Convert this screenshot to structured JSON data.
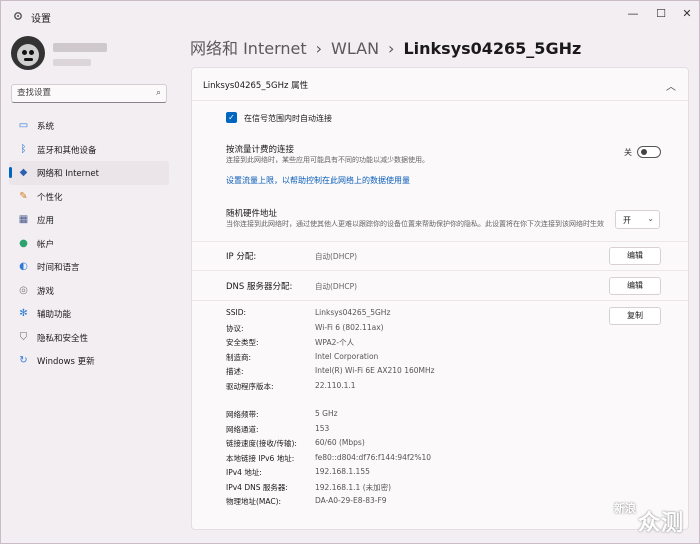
{
  "window": {
    "title": "设置",
    "min_icon": "minimize-icon",
    "max_icon": "maximize-icon",
    "close_icon": "close-icon"
  },
  "search": {
    "placeholder": "查找设置"
  },
  "nav": {
    "items": [
      {
        "label": "系统",
        "icon": "monitor-icon",
        "color": "#2f7bd6",
        "active": false
      },
      {
        "label": "蓝牙和其他设备",
        "icon": "bluetooth-icon",
        "color": "#1e6ec8",
        "active": false
      },
      {
        "label": "网络和 Internet",
        "icon": "wifi-icon",
        "color": "#2d5fb3",
        "active": true
      },
      {
        "label": "个性化",
        "icon": "brush-icon",
        "color": "#d27a1e",
        "active": false
      },
      {
        "label": "应用",
        "icon": "apps-icon",
        "color": "#4a5a8a",
        "active": false
      },
      {
        "label": "帐户",
        "icon": "account-icon",
        "color": "#2aa36c",
        "active": false
      },
      {
        "label": "时间和语言",
        "icon": "globe-clock-icon",
        "color": "#2f7bd6",
        "active": false
      },
      {
        "label": "游戏",
        "icon": "gamepad-icon",
        "color": "#777777",
        "active": false
      },
      {
        "label": "辅助功能",
        "icon": "accessibility-icon",
        "color": "#2f7bd6",
        "active": false
      },
      {
        "label": "隐私和安全性",
        "icon": "shield-icon",
        "color": "#666666",
        "active": false
      },
      {
        "label": "Windows 更新",
        "icon": "update-icon",
        "color": "#2f7bd6",
        "active": false
      }
    ]
  },
  "breadcrumb": {
    "part1": "网络和 Internet",
    "part2": "WLAN",
    "current": "Linksys04265_5GHz"
  },
  "panel": {
    "title": "Linksys04265_5GHz 属性",
    "auto_connect": {
      "label": "在信号范围内时自动连接",
      "checked": true
    },
    "metered": {
      "label": "按流量计费的连接",
      "sub": "连接到此网络时，某些应用可能具有不同的功能以减少数据使用。",
      "toggle_text": "关",
      "on": false
    },
    "data_limit_link": "设置流量上限，以帮助控制在此网络上的数据使用量",
    "random_mac": {
      "label": "随机硬件地址",
      "sub": "当你连接到此网络时，通过使其他人更难以跟踪你的设备位置来帮助保护你的隐私。此设置将在你下次连接到该网络时生效",
      "value": "开"
    },
    "ip": {
      "label": "IP 分配:",
      "value": "自动(DHCP)",
      "button": "编辑"
    },
    "dns": {
      "label": "DNS 服务器分配:",
      "value": "自动(DHCP)",
      "button": "编辑"
    },
    "copy_button": "复制",
    "props1": [
      {
        "k": "SSID:",
        "v": "Linksys04265_5GHz"
      },
      {
        "k": "协议:",
        "v": "Wi-Fi 6 (802.11ax)"
      },
      {
        "k": "安全类型:",
        "v": "WPA2-个人"
      },
      {
        "k": "制造商:",
        "v": "Intel Corporation"
      },
      {
        "k": "描述:",
        "v": "Intel(R) Wi-Fi 6E AX210 160MHz"
      },
      {
        "k": "驱动程序版本:",
        "v": "22.110.1.1"
      }
    ],
    "props2": [
      {
        "k": "网络频带:",
        "v": "5 GHz"
      },
      {
        "k": "网络通道:",
        "v": "153"
      },
      {
        "k": "链接速度(接收/传输):",
        "v": "60/60 (Mbps)"
      },
      {
        "k": "本地链接 IPv6 地址:",
        "v": "fe80::d804:df76:f144:94f2%10"
      },
      {
        "k": "IPv4 地址:",
        "v": "192.168.1.155"
      },
      {
        "k": "IPv4 DNS 服务器:",
        "v": "192.168.1.1 (未加密)"
      },
      {
        "k": "物理地址(MAC):",
        "v": "DA-A0-29-E8-83-F9"
      }
    ]
  },
  "watermark": {
    "box": "新浪",
    "text": "众测"
  },
  "colors": {
    "accent": "#0067c0",
    "link": "#0a5db8"
  }
}
